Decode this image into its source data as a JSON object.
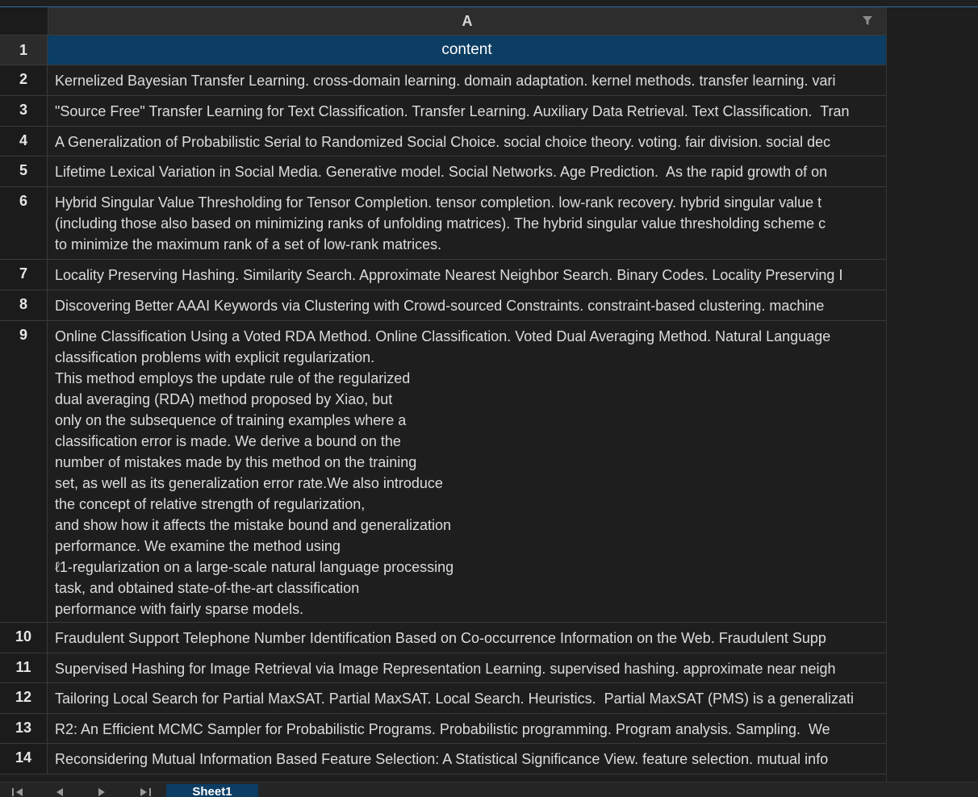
{
  "top_strip_text": "",
  "column_header": {
    "letter": "A",
    "filter_icon": "filter-icon"
  },
  "rows": [
    {
      "num": "1",
      "text": "content"
    },
    {
      "num": "2",
      "text": "Kernelized Bayesian Transfer Learning. cross-domain learning. domain adaptation. kernel methods. transfer learning. vari"
    },
    {
      "num": "3",
      "text": "\"Source Free\" Transfer Learning for Text Classification. Transfer Learning. Auxiliary Data Retrieval. Text Classification.  Tran"
    },
    {
      "num": "4",
      "text": "A Generalization of Probabilistic Serial to Randomized Social Choice. social choice theory. voting. fair division. social dec"
    },
    {
      "num": "5",
      "text": "Lifetime Lexical Variation in Social Media. Generative model. Social Networks. Age Prediction.  As the rapid growth of on"
    },
    {
      "num": "6",
      "text": "Hybrid Singular Value Thresholding for Tensor Completion. tensor completion. low-rank recovery. hybrid singular value t\n(including those also based on minimizing ranks of unfolding matrices). The hybrid singular value thresholding scheme c\nto minimize the maximum rank of a set of low-rank matrices."
    },
    {
      "num": "7",
      "text": "Locality Preserving Hashing. Similarity Search. Approximate Nearest Neighbor Search. Binary Codes. Locality Preserving I"
    },
    {
      "num": "8",
      "text": "Discovering Better AAAI Keywords via Clustering with Crowd-sourced Constraints. constraint-based clustering. machine"
    },
    {
      "num": "9",
      "text": "Online Classification Using a Voted RDA Method. Online Classification. Voted Dual Averaging Method. Natural Language\nclassification problems with explicit regularization.\nThis method employs the update rule of the regularized\ndual averaging (RDA) method proposed by Xiao, but\nonly on the subsequence of training examples where a\nclassification error is made. We derive a bound on the\nnumber of mistakes made by this method on the training\nset, as well as its generalization error rate.We also introduce\nthe concept of relative strength of regularization,\nand show how it affects the mistake bound and generalization\nperformance. We examine the method using\nℓ1-regularization on a large-scale natural language processing\ntask, and obtained state-of-the-art classification\nperformance with fairly sparse models."
    },
    {
      "num": "10",
      "text": "Fraudulent Support Telephone Number Identification Based on Co-occurrence Information on the Web. Fraudulent Supp"
    },
    {
      "num": "11",
      "text": "Supervised Hashing for Image Retrieval via Image Representation Learning. supervised hashing. approximate near neigh"
    },
    {
      "num": "12",
      "text": "Tailoring Local Search for Partial MaxSAT. Partial MaxSAT. Local Search. Heuristics.  Partial MaxSAT (PMS) is a generalizati"
    },
    {
      "num": "13",
      "text": "R2: An Efficient MCMC Sampler for Probabilistic Programs. Probabilistic programming. Program analysis. Sampling.  We"
    },
    {
      "num": "14",
      "text": "Reconsidering Mutual Information Based Feature Selection: A Statistical Significance View. feature selection. mutual info"
    }
  ],
  "footer": {
    "sheet_tab": "Sheet1",
    "nav_icons": [
      "first-sheet-icon",
      "prev-sheet-icon",
      "next-sheet-icon",
      "last-sheet-icon"
    ]
  },
  "colors": {
    "header_row_bg": "#0c3d63",
    "grid_bg": "#1e1e1e",
    "border": "#3a3a3a"
  }
}
